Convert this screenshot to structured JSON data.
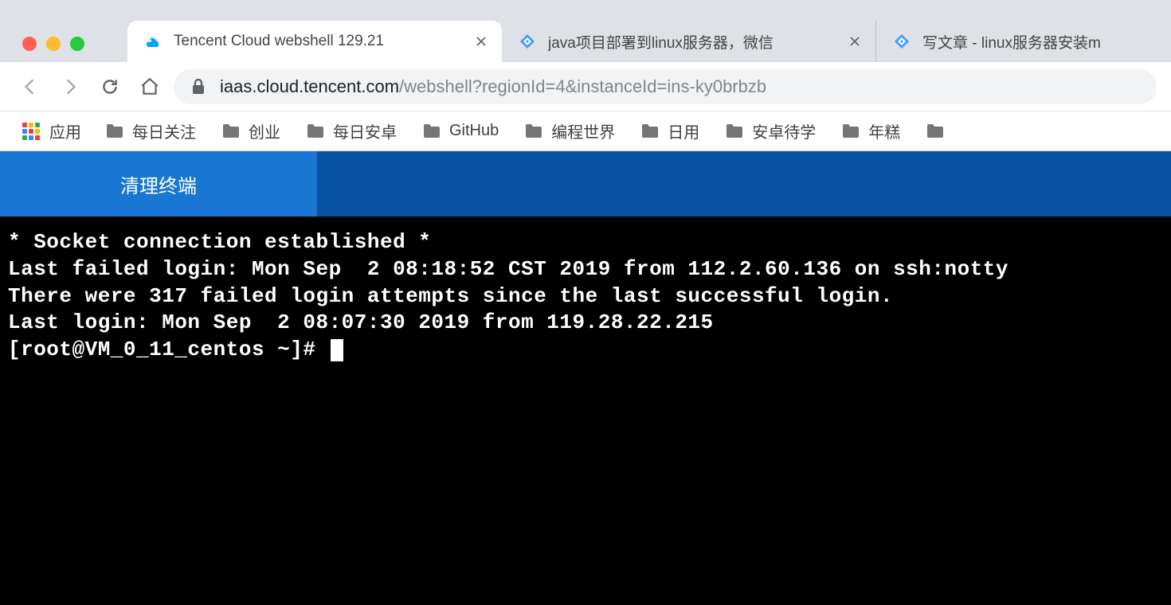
{
  "tabs": [
    {
      "title": "Tencent Cloud webshell 129.21",
      "favicon": "cloud",
      "active": true
    },
    {
      "title": "java项目部署到linux服务器，微信",
      "favicon": "csdn",
      "active": false
    },
    {
      "title": "写文章 - linux服务器安装m",
      "favicon": "csdn",
      "active": false
    }
  ],
  "url": {
    "host": "iaas.cloud.tencent.com",
    "path": "/webshell?regionId=4&instanceId=ins-ky0brbzb"
  },
  "bookmarks": {
    "apps_label": "应用",
    "items": [
      "每日关注",
      "创业",
      "每日安卓",
      "GitHub",
      "编程世界",
      "日用",
      "安卓待学",
      "年糕"
    ]
  },
  "terminal": {
    "button_label": "清理终端",
    "lines": [
      "* Socket connection established *",
      "Last failed login: Mon Sep  2 08:18:52 CST 2019 from 112.2.60.136 on ssh:notty",
      "There were 317 failed login attempts since the last successful login.",
      "Last login: Mon Sep  2 08:07:30 2019 from 119.28.22.215"
    ],
    "prompt": "[root@VM_0_11_centos ~]# "
  },
  "apps_grid_colors": [
    "#ea4335",
    "#fbbc05",
    "#34a853",
    "#4285f4",
    "#ea4335",
    "#fbbc05",
    "#34a853",
    "#4285f4",
    "#ea4335"
  ]
}
